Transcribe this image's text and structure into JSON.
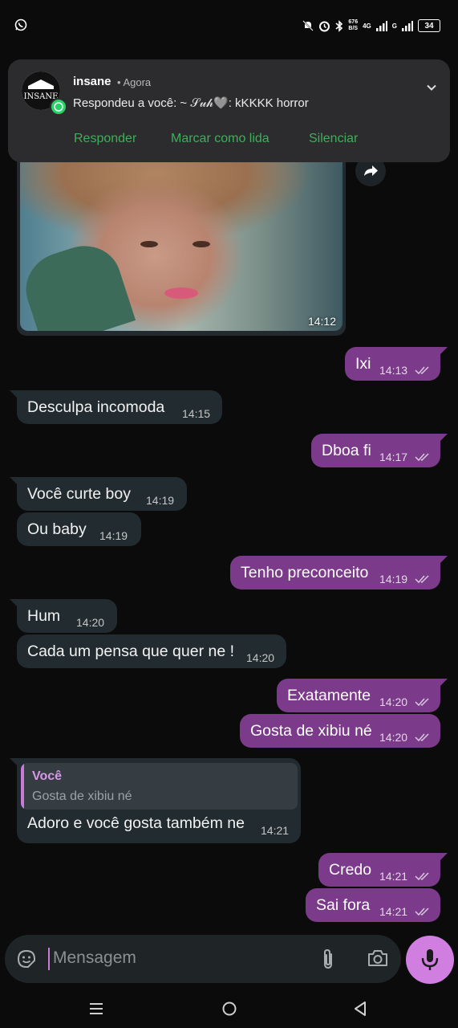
{
  "status_bar": {
    "net_speed_value": "676",
    "net_speed_unit": "B/S",
    "network_4g": "4G",
    "network_g": "G",
    "battery": "34",
    "icons": [
      "whatsapp-icon",
      "bell-off-icon",
      "alarm-icon",
      "bluetooth-icon",
      "signal-icon",
      "signal-icon",
      "battery-icon"
    ]
  },
  "notification": {
    "app_name": "insane",
    "time": "• Agora",
    "text": "Respondeu a você: ~ 𝒮𝓊𝒽🩶: kKKKK horror",
    "avatar_text": "INSANE",
    "actions": [
      "Responder",
      "Marcar como lida",
      "Silenciar"
    ]
  },
  "image_message": {
    "time": "14:12"
  },
  "messages": [
    {
      "dir": "out",
      "text": "Ixi",
      "time": "14:13"
    },
    {
      "dir": "in",
      "text": "Desculpa incomoda",
      "time": "14:15"
    },
    {
      "dir": "out",
      "text": "Dboa fi",
      "time": "14:17"
    },
    {
      "dir": "in",
      "text": "Você curte boy",
      "time": "14:19"
    },
    {
      "dir": "in",
      "text": "Ou baby",
      "time": "14:19"
    },
    {
      "dir": "out",
      "text": "Tenho preconceito",
      "time": "14:19"
    },
    {
      "dir": "in",
      "text": "Hum",
      "time": "14:20"
    },
    {
      "dir": "in",
      "text": "Cada um pensa que quer ne !",
      "time": "14:20"
    },
    {
      "dir": "out",
      "text": "Exatamente",
      "time": "14:20"
    },
    {
      "dir": "out",
      "text": "Gosta de xibiu né",
      "time": "14:20"
    },
    {
      "dir": "out",
      "text": "Credo",
      "time": "14:21"
    },
    {
      "dir": "out",
      "text": "Sai fora",
      "time": "14:21"
    }
  ],
  "reply_message": {
    "quoted_author": "Você",
    "quoted_text": "Gosta de xibiu né",
    "text": "Adoro e você gosta também ne",
    "time": "14:21"
  },
  "composer": {
    "placeholder": "Mensagem"
  },
  "colors": {
    "background": "#0b0b0c",
    "incoming": "#222b30",
    "outgoing": "#7b3a8a",
    "accent": "#d07fe0",
    "notification_action": "#3fae5a"
  }
}
